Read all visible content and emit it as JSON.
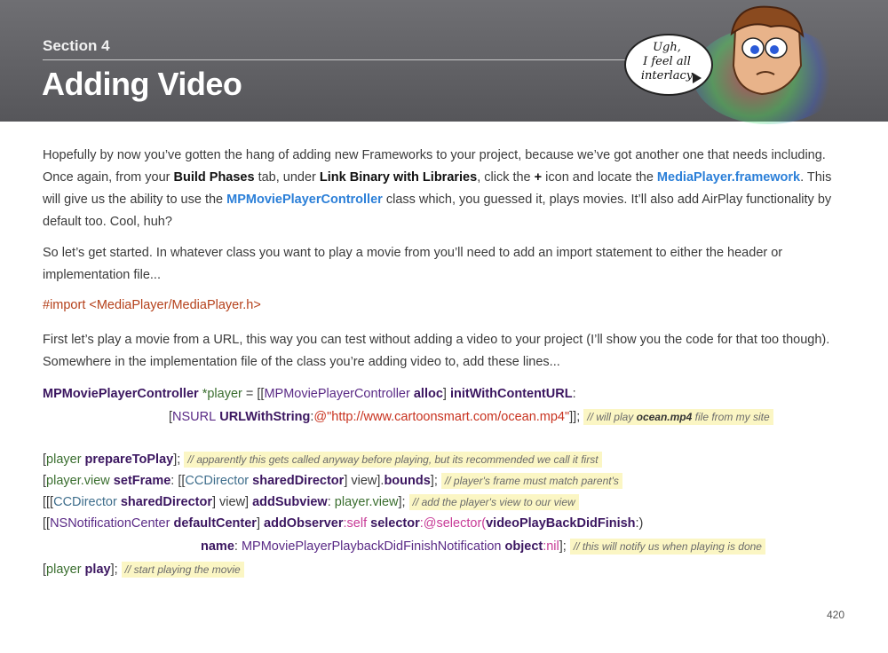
{
  "header": {
    "section": "Section 4",
    "title": "Adding Video",
    "bubble_lines": [
      "Ugh,",
      "I feel all",
      "interlacy"
    ]
  },
  "para1": {
    "t1": "Hopefully by now you’ve gotten the hang of adding new Frameworks to your project, because we’ve got another one that needs including. Once again, from your ",
    "b1": "Build Phases",
    "t2": " tab, under ",
    "b2": "Link Binary with Libraries",
    "t3": ", click the ",
    "b3": "+",
    "t4": " icon and locate the ",
    "l1": "MediaPlayer.framework",
    "t5": ". This will give us the ability to use the ",
    "l2": "MPMoviePlayerController",
    "t6": " class which, you guessed it, plays movies. It’ll also add AirPlay functionality by default too. Cool, huh?"
  },
  "para2": "So let’s get started. In whatever class you want to play a movie from you’ll need to add an import statement to either the header or implementation file...",
  "import_line": {
    "kw": "#import",
    "path": " <MediaPlayer/MediaPlayer.h>"
  },
  "para3": "First let’s play a movie from a URL, this way you can test without adding a video to your project (I’ll show you the code for that too though). Somewhere in the implementation file of the class you’re adding video to, add these lines...",
  "code": {
    "l1": {
      "a": "MPMoviePlayerController",
      "b": " *player",
      "c": " = [[",
      "d": "MPMoviePlayerController",
      "e": " alloc",
      "f": "] ",
      "g": "initWithContentURL",
      "h": ":"
    },
    "l2": {
      "a": "[",
      "b": "NSURL",
      "c": " URLWithString",
      "d": ":",
      "e": "@\"http://www.cartoonsmart.com/ocean.mp4\"",
      "f": "]];",
      "c1": "// will play ",
      "c2": "ocean.mp4",
      "c3": " file from my site"
    },
    "l3": {
      "a": "[",
      "b": "player",
      "c": " prepareToPlay",
      "d": "];",
      "com": "// apparently this gets called anyway before playing, but its recommended we call it first"
    },
    "l4": {
      "a": "[",
      "b": "player",
      "c": ".view",
      "d": " setFrame",
      "e": ": [[",
      "f": "CCDirector",
      "g": " sharedDirector",
      "h": "] view].",
      "i": "bounds",
      "j": "];",
      "com": "// player's frame must match parent's"
    },
    "l5": {
      "a": "[[[",
      "b": "CCDirector",
      "c": " sharedDirector",
      "d": "] view] ",
      "e": "addSubview",
      "f": ": ",
      "g": "player",
      "h": ".view",
      "i": "];",
      "com": "// add the player's view to our view"
    },
    "l6": {
      "a": "[[",
      "b": "NSNotificationCenter",
      "c": " defaultCenter",
      "d": "] ",
      "e": "addObserver",
      "f": ":self ",
      "g": "selector",
      "h": ":@selector(",
      "i": "videoPlayBackDidFinish",
      "j": ":)"
    },
    "l7": {
      "a": "name",
      "b": ": ",
      "c": "MPMoviePlayerPlaybackDidFinishNotification",
      "d": " object",
      "e": ":nil",
      "f": "];",
      "com": "// this will notify us when playing is done"
    },
    "l8": {
      "a": "[",
      "b": "player",
      "c": " play",
      "d": "];",
      "com": "// start playing the movie"
    }
  },
  "page_number": "420"
}
